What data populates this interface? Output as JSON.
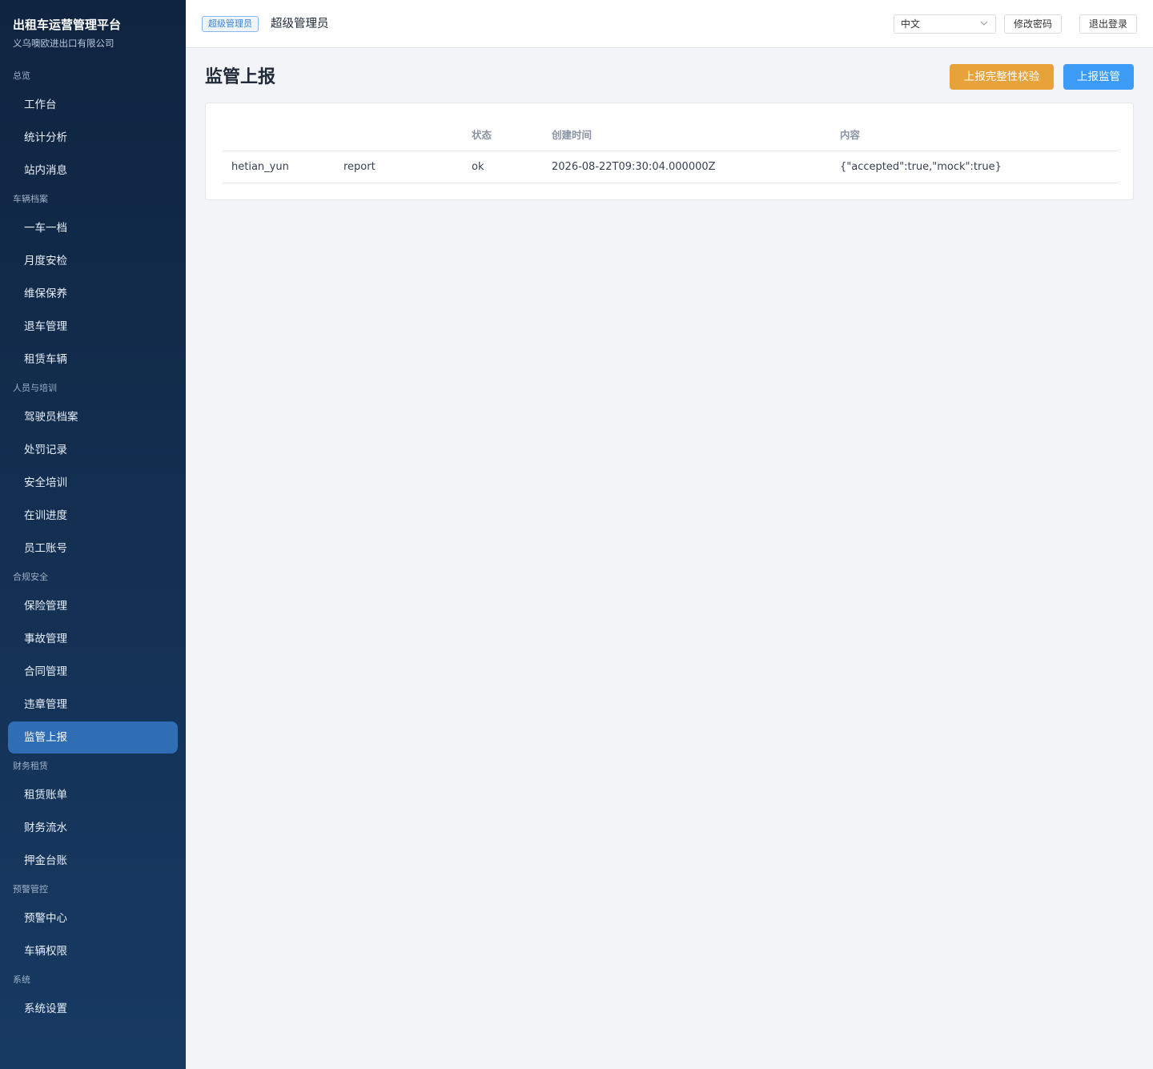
{
  "brand": {
    "title": "出租车运营管理平台",
    "subtitle": "义乌噢欧进出口有限公司"
  },
  "sidebar": {
    "groups": [
      {
        "title": "总览",
        "items": [
          "工作台",
          "统计分析",
          "站内消息"
        ]
      },
      {
        "title": "车辆档案",
        "items": [
          "一车一档",
          "月度安检",
          "维保保养",
          "退车管理",
          "租赁车辆"
        ]
      },
      {
        "title": "人员与培训",
        "items": [
          "驾驶员档案",
          "处罚记录",
          "安全培训",
          "在训进度",
          "员工账号"
        ]
      },
      {
        "title": "合规安全",
        "items": [
          "保险管理",
          "事故管理",
          "合同管理",
          "违章管理",
          "监管上报"
        ]
      },
      {
        "title": "财务租赁",
        "items": [
          "租赁账单",
          "财务流水",
          "押金台账"
        ]
      },
      {
        "title": "预警管控",
        "items": [
          "预警中心",
          "车辆权限"
        ]
      },
      {
        "title": "系统",
        "items": [
          "系统设置"
        ]
      }
    ],
    "active_item": "监管上报"
  },
  "topbar": {
    "role_badge": "超级管理员",
    "role_name": "超级管理员",
    "language": "中文",
    "change_password": "修改密码",
    "logout": "退出登录"
  },
  "page": {
    "title": "监管上报",
    "verify_button": "上报完整性校验",
    "report_button": "上报监管"
  },
  "table": {
    "headers": [
      "",
      "",
      "状态",
      "创建时间",
      "内容"
    ],
    "rows": [
      [
        "hetian_yun",
        "report",
        "ok",
        "2026-08-22T09:30:04.000000Z",
        "{\"accepted\":true,\"mock\":true}"
      ]
    ]
  },
  "colors": {
    "sidebar_top": "#0f2440",
    "sidebar_bottom": "#173a63",
    "active_item": "#2f6db5",
    "verify_button": "#e8a23a",
    "report_button": "#3b9bf5"
  }
}
